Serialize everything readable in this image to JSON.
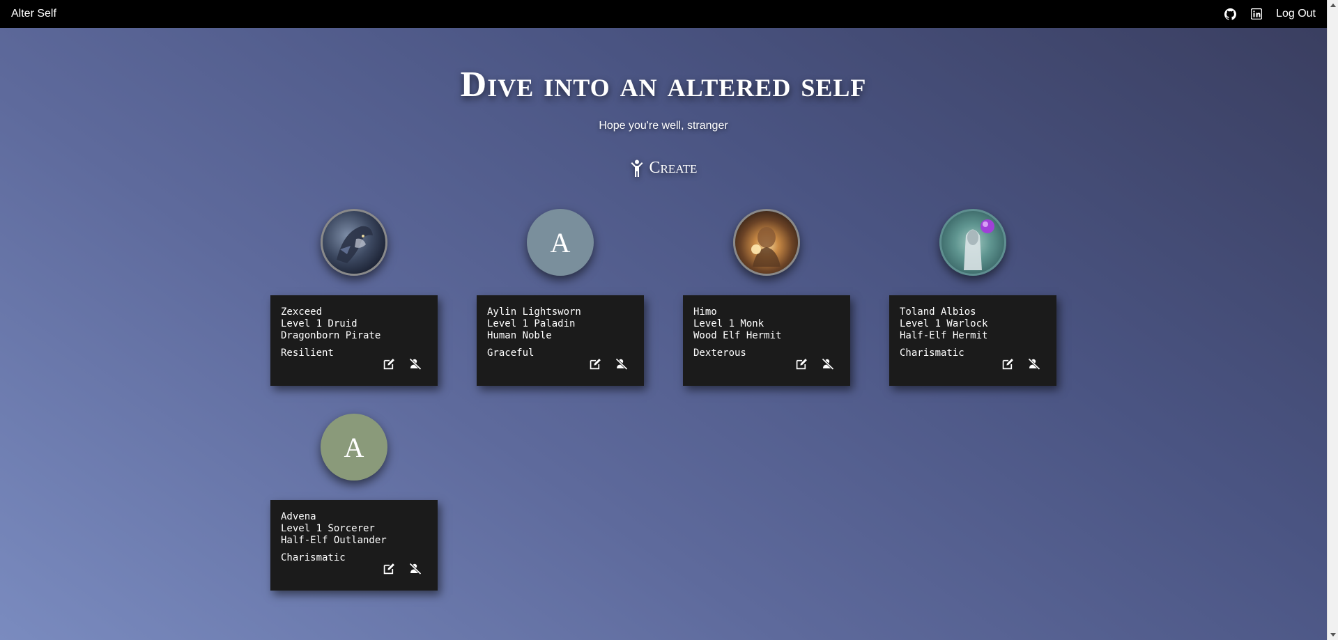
{
  "nav": {
    "brand": "Alter Self",
    "github_icon": "github-icon",
    "linkedin_icon": "linkedin-icon",
    "logout_label": "Log Out"
  },
  "hero": {
    "title": "Dive into an altered self",
    "subtitle": "Hope you're well, stranger",
    "create_label": "Create",
    "create_icon": "person-icon"
  },
  "characters": [
    {
      "name": "Zexceed",
      "level": "Level 1 Druid",
      "origin": "Dragonborn Pirate",
      "trait": "Resilient",
      "avatar_letter": "",
      "avatar_color": "#4a5a6a"
    },
    {
      "name": "Aylin Lightsworn",
      "level": "Level 1 Paladin",
      "origin": "Human Noble",
      "trait": "Graceful",
      "avatar_letter": "A",
      "avatar_color": "#7a8f9c"
    },
    {
      "name": "Himo",
      "level": "Level 1 Monk",
      "origin": "Wood Elf Hermit",
      "trait": "Dexterous",
      "avatar_letter": "",
      "avatar_color": "#6b4a30"
    },
    {
      "name": "Toland Albios",
      "level": "Level 1 Warlock",
      "origin": "Half-Elf Hermit",
      "trait": "Charismatic",
      "avatar_letter": "",
      "avatar_color": "#5a8a8a"
    },
    {
      "name": "Advena",
      "level": "Level 1 Sorcerer",
      "origin": "Half-Elf Outlander",
      "trait": "Charismatic",
      "avatar_letter": "A",
      "avatar_color": "#8a9a7a"
    }
  ],
  "colors": {
    "card_bg": "#1b1b1b",
    "navbar_bg": "#000000"
  }
}
